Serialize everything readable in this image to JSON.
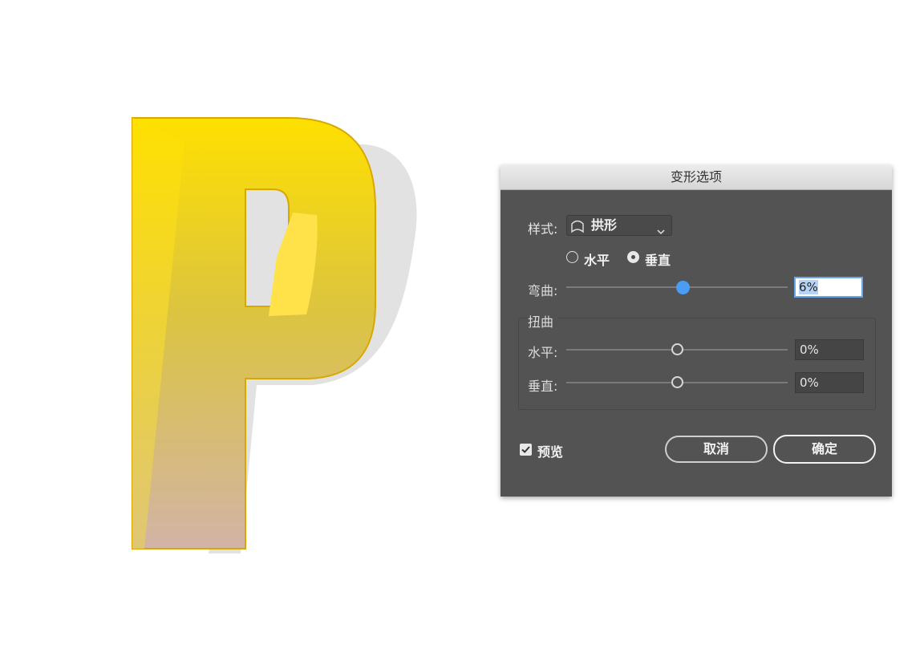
{
  "dialog": {
    "title": "变形选项",
    "style_label": "样式:",
    "style_value": "拱形",
    "orientation": {
      "options": [
        {
          "label": "水平",
          "selected": false
        },
        {
          "label": "垂直",
          "selected": true
        }
      ]
    },
    "bend": {
      "label": "弯曲:",
      "value": "6%",
      "slider_fraction": 0.53
    },
    "distortion": {
      "group_label": "扭曲",
      "horizontal": {
        "label": "水平:",
        "value": "0%",
        "slider_fraction": 0.5
      },
      "vertical": {
        "label": "垂直:",
        "value": "0%",
        "slider_fraction": 0.5
      }
    },
    "preview": {
      "label": "预览",
      "checked": true
    },
    "cancel_label": "取消",
    "ok_label": "确定"
  },
  "colors": {
    "dialog_bg": "#535353",
    "accent": "#4a9cf5",
    "letter_top": "#ffe100",
    "letter_bottom": "#d2b0a5",
    "shadow": "#e0e0e0"
  },
  "icons": [
    "arc-style-icon",
    "chevron-down-icon",
    "checkbox-check-icon"
  ]
}
